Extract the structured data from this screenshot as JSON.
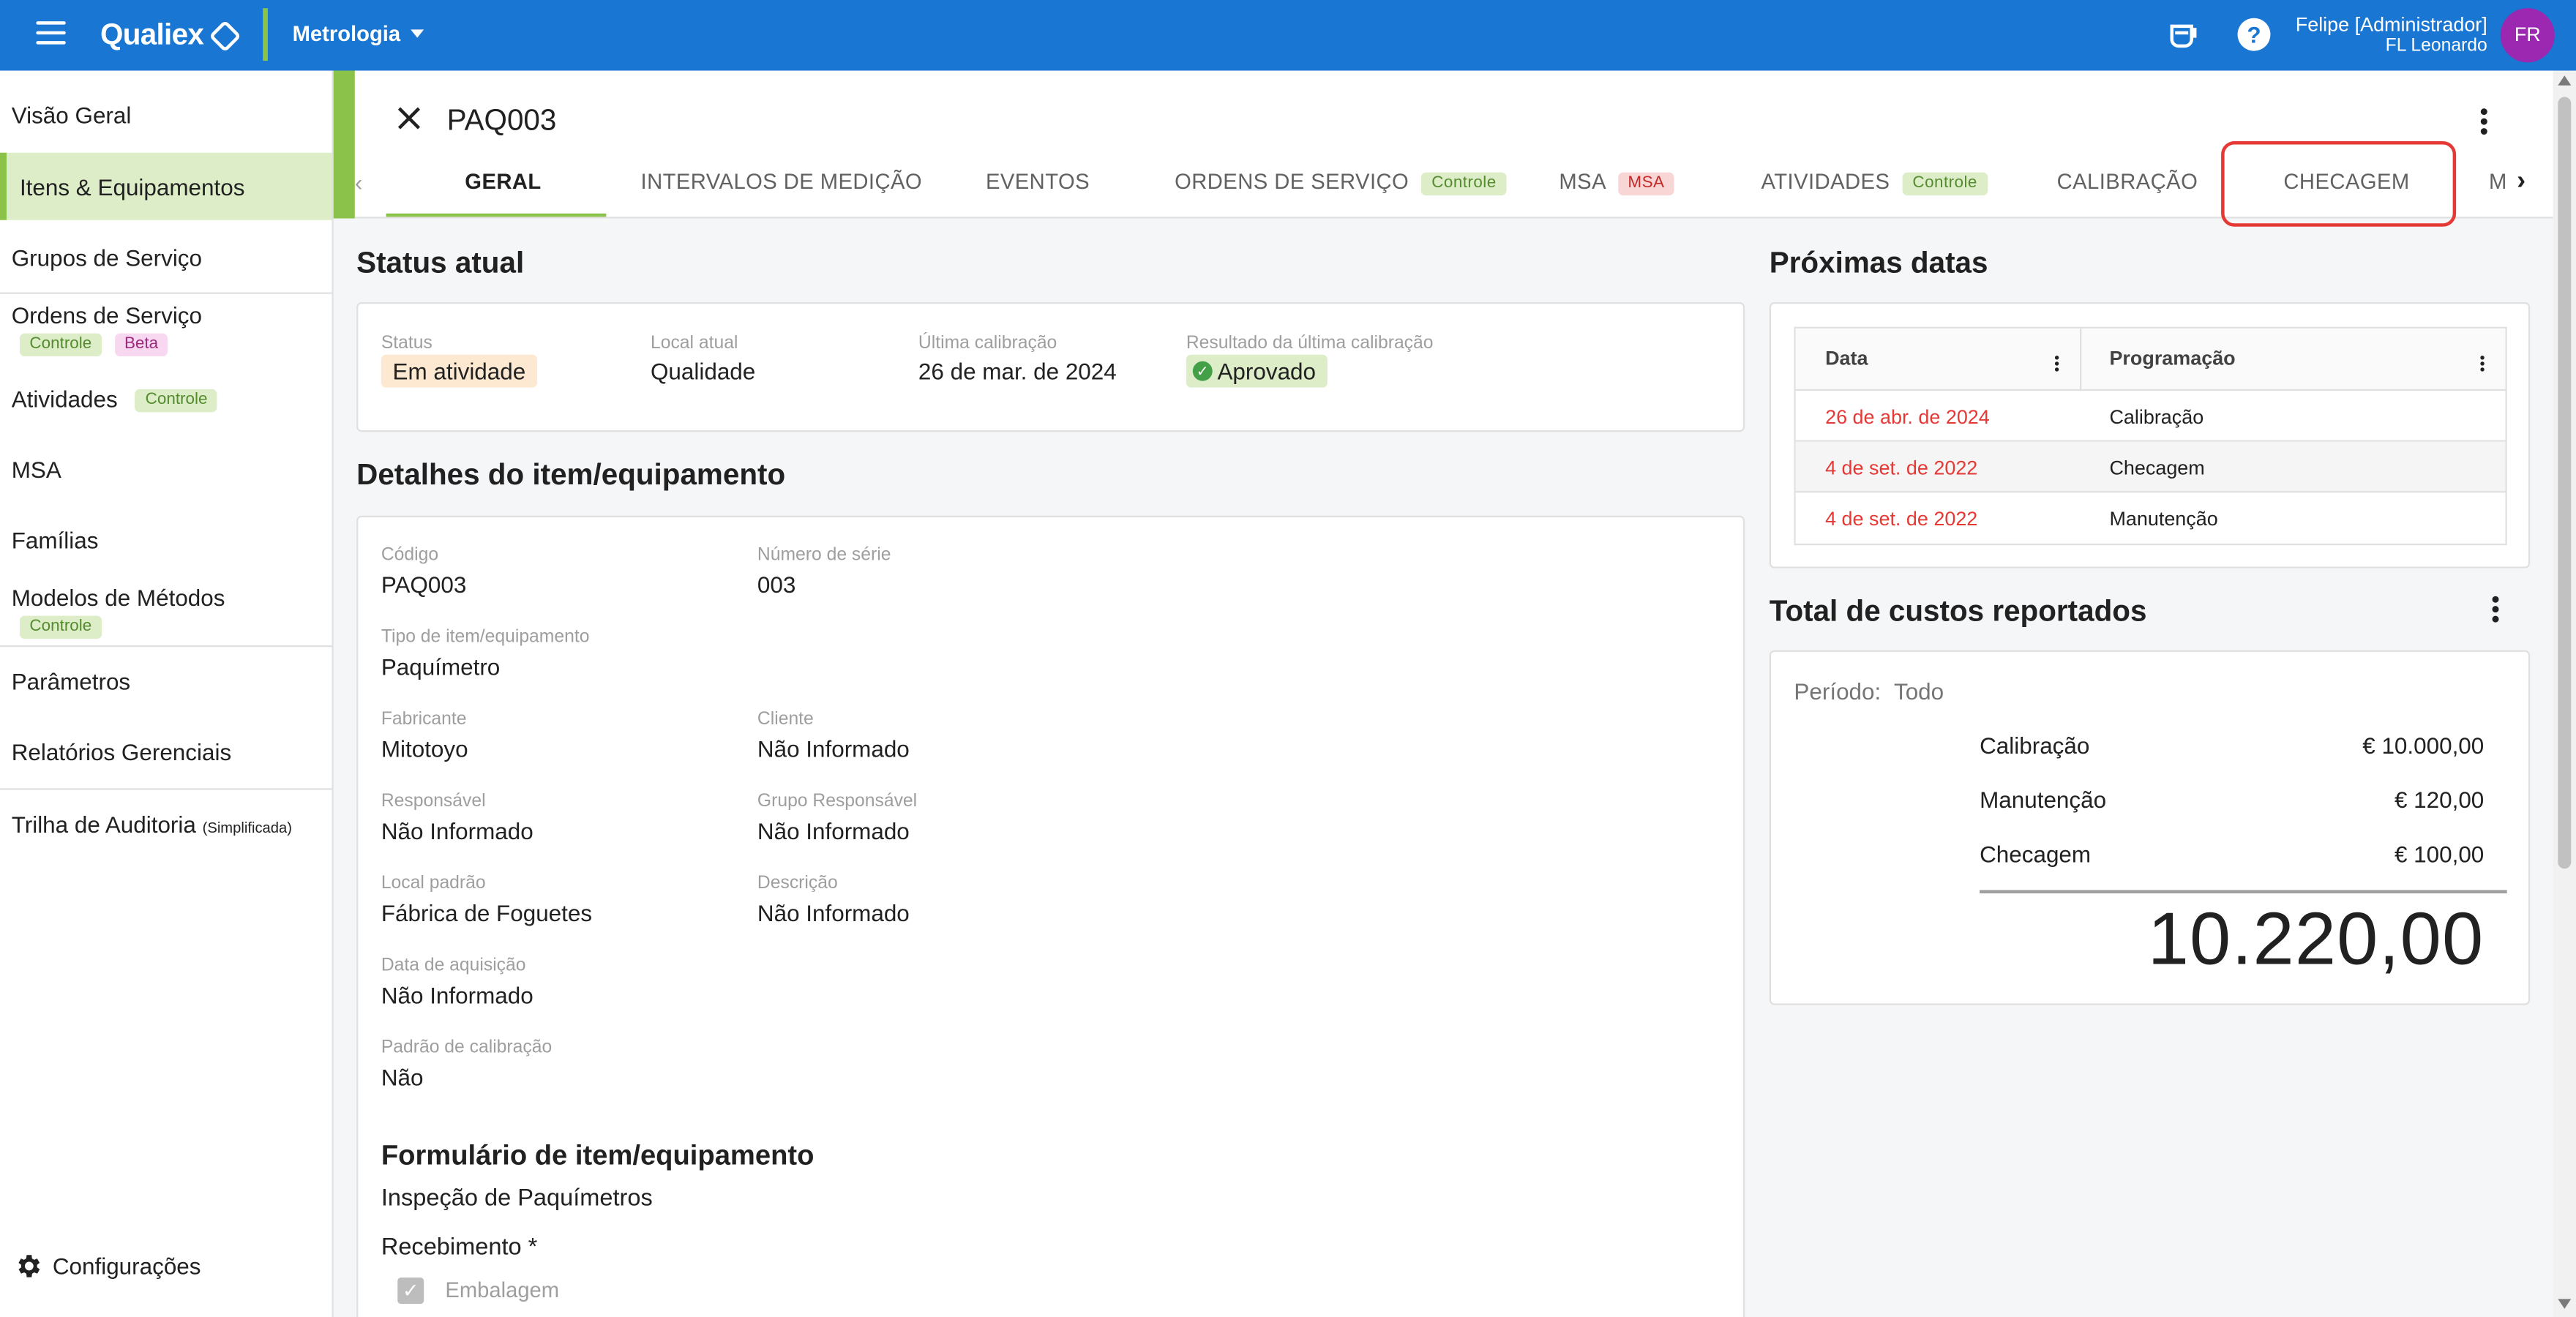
{
  "topbar": {
    "brand": "Qualiex",
    "module": "Metrologia",
    "user_name": "Felipe [Administrador]",
    "user_company": "FL Leonardo",
    "avatar_initials": "FR",
    "help_label": "?"
  },
  "sidebar": {
    "items": [
      {
        "label": "Visão Geral"
      },
      {
        "label": "Itens & Equipamentos"
      },
      {
        "label": "Grupos de Serviço"
      },
      {
        "label": "Ordens de Serviço",
        "tags": [
          "Controle",
          "Beta"
        ]
      },
      {
        "label": "Atividades",
        "tags": [
          "Controle"
        ]
      },
      {
        "label": "MSA"
      },
      {
        "label": "Famílias"
      },
      {
        "label": "Modelos de Métodos",
        "tags": [
          "Controle"
        ]
      },
      {
        "label": "Parâmetros"
      },
      {
        "label": "Relatórios Gerenciais"
      },
      {
        "label": "Trilha de Auditoria",
        "suffix": "(Simplificada)"
      }
    ],
    "config_label": "Configurações"
  },
  "header": {
    "title": "PAQ003",
    "tabs": [
      {
        "label": "GERAL"
      },
      {
        "label": "INTERVALOS DE MEDIÇÃO"
      },
      {
        "label": "EVENTOS"
      },
      {
        "label": "ORDENS DE SERVIÇO",
        "tag": "Controle"
      },
      {
        "label": "MSA",
        "tag": "MSA"
      },
      {
        "label": "ATIVIDADES",
        "tag": "Controle"
      },
      {
        "label": "CALIBRAÇÃO"
      },
      {
        "label": "CHECAGEM"
      },
      {
        "label": "M"
      }
    ]
  },
  "status": {
    "section_title": "Status atual",
    "status_label": "Status",
    "status_value": "Em atividade",
    "location_label": "Local atual",
    "location_value": "Qualidade",
    "last_cal_label": "Última calibração",
    "last_cal_value": "26 de mar. de 2024",
    "last_result_label": "Resultado da última calibração",
    "last_result_value": "Aprovado"
  },
  "details": {
    "section_title": "Detalhes do item/equipamento",
    "fields": {
      "codigo": {
        "label": "Código",
        "value": "PAQ003"
      },
      "serie": {
        "label": "Número de série",
        "value": "003"
      },
      "tipo": {
        "label": "Tipo de item/equipamento",
        "value": "Paquímetro"
      },
      "fabricante": {
        "label": "Fabricante",
        "value": "Mitotoyo"
      },
      "cliente": {
        "label": "Cliente",
        "value": "Não Informado"
      },
      "responsavel": {
        "label": "Responsável",
        "value": "Não Informado"
      },
      "grupo": {
        "label": "Grupo Responsável",
        "value": "Não Informado"
      },
      "local": {
        "label": "Local padrão",
        "value": "Fábrica de Foguetes"
      },
      "descricao": {
        "label": "Descrição",
        "value": "Não Informado"
      },
      "aquisicao": {
        "label": "Data de aquisição",
        "value": "Não Informado"
      },
      "padrao": {
        "label": "Padrão de calibração",
        "value": "Não"
      }
    },
    "form_title": "Formulário de item/equipamento",
    "form_name": "Inspeção de Paquímetros",
    "form_question": "Recebimento *",
    "form_option": "Embalagem"
  },
  "next_dates": {
    "section_title": "Próximas datas",
    "col_date": "Data",
    "col_prog": "Programação",
    "rows": [
      {
        "date": "26 de abr. de 2024",
        "prog": "Calibração"
      },
      {
        "date": "4 de set. de 2022",
        "prog": "Checagem"
      },
      {
        "date": "4 de set. de 2022",
        "prog": "Manutenção"
      }
    ]
  },
  "costs": {
    "section_title": "Total de custos reportados",
    "period_label": "Período:",
    "period_value": "Todo",
    "lines": [
      {
        "label": "Calibração",
        "amount": "€ 10.000,00"
      },
      {
        "label": "Manutenção",
        "amount": "€ 120,00"
      },
      {
        "label": "Checagem",
        "amount": "€ 100,00"
      }
    ],
    "total": "10.220,00"
  }
}
